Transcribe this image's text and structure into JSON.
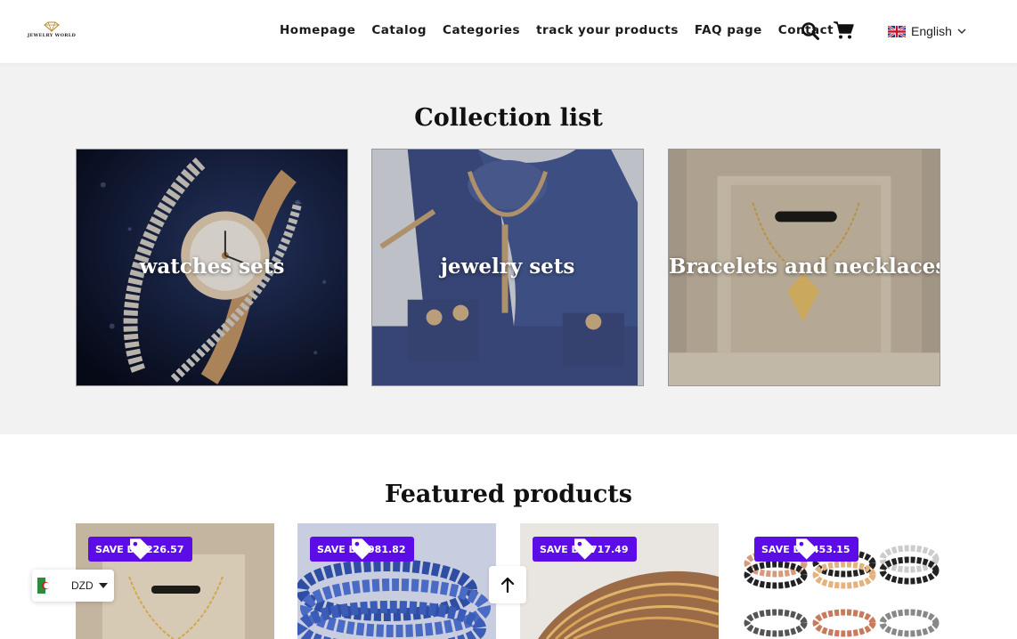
{
  "header": {
    "logo_text": "JEWELRY WORLD",
    "nav": [
      "Homepage",
      "Catalog",
      "Categories",
      "track your products",
      "FAQ page",
      "Contact"
    ],
    "language": "English"
  },
  "collection": {
    "title": "Collection list",
    "cards": [
      {
        "label": "watches sets"
      },
      {
        "label": "jewelry sets"
      },
      {
        "label": "Bracelets and necklaces"
      }
    ]
  },
  "featured": {
    "title": "Featured products",
    "products": [
      {
        "badge": "SAVE DA 226.57"
      },
      {
        "badge": "SAVE DA 981.82"
      },
      {
        "badge": "SAVE DA 717.49"
      },
      {
        "badge": "SAVE DA 453.15"
      }
    ]
  },
  "currency": {
    "code": "DZD"
  },
  "colors": {
    "badge": "#5c0ce6",
    "section_bg": "#f2f2f2"
  },
  "icons": [
    "search-icon",
    "cart-icon",
    "uk-flag-icon",
    "chevron-down-icon",
    "tag-icon",
    "algeria-flag-icon",
    "caret-down-icon",
    "arrow-up-icon"
  ]
}
